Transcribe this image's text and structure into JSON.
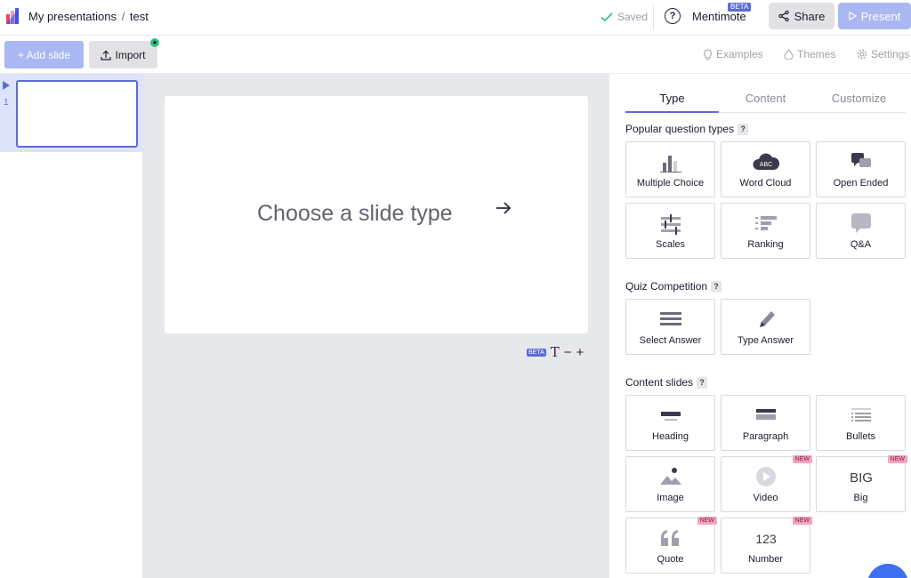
{
  "header": {
    "breadcrumb_root": "My presentations",
    "breadcrumb_separator": "/",
    "breadcrumb_current": "test",
    "saved_label": "Saved",
    "mentimote_label": "Mentimote",
    "mentimote_badge": "BETA",
    "share_label": "Share",
    "present_label": "Present"
  },
  "toolbar": {
    "add_slide_label": "+ Add slide",
    "import_label": "Import",
    "examples_label": "Examples",
    "themes_label": "Themes",
    "settings_label": "Settings"
  },
  "slides": [
    {
      "number": "1"
    }
  ],
  "canvas": {
    "prompt": "Choose a slide type",
    "beta_badge": "BETA",
    "text_tool": "T",
    "zoom_out": "−",
    "zoom_in": "+"
  },
  "panel": {
    "tabs": [
      "Type",
      "Content",
      "Customize"
    ],
    "active_tab": "Type",
    "help_glyph": "?",
    "new_badge": "NEW",
    "sections": {
      "popular": "Popular question types",
      "quiz": "Quiz Competition",
      "content": "Content slides"
    },
    "popular_tiles": [
      "Multiple Choice",
      "Word Cloud",
      "Open Ended",
      "Scales",
      "Ranking",
      "Q&A"
    ],
    "quiz_tiles": [
      "Select Answer",
      "Type Answer"
    ],
    "content_tiles": [
      "Heading",
      "Paragraph",
      "Bullets",
      "Image",
      "Video",
      "Big",
      "Quote",
      "Number"
    ],
    "icon_text": {
      "word_cloud": "ABC",
      "big": "BIG",
      "number": "123"
    }
  },
  "colors": {
    "accent": "#5b6cd8",
    "present_button": "#a9b8f3",
    "new_badge": "#f5a4bd",
    "saved_check": "#2ec27e"
  }
}
